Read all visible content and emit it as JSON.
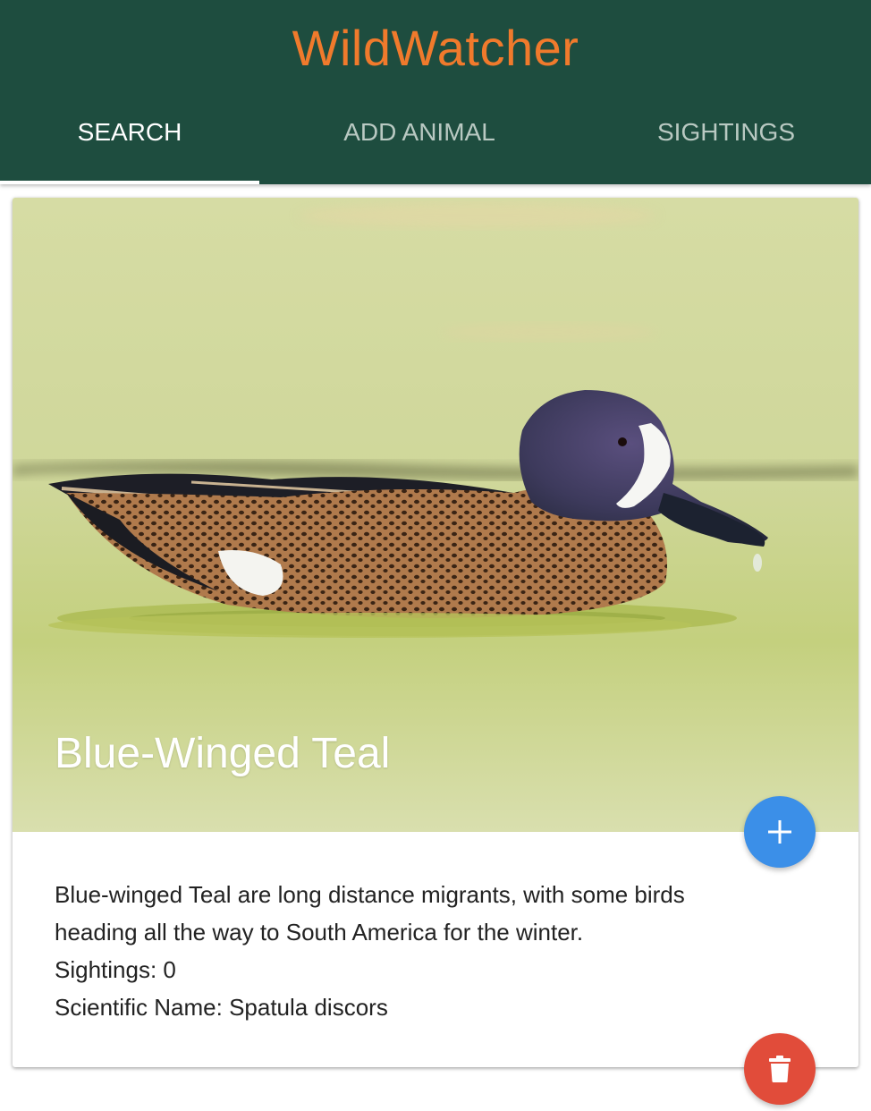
{
  "app": {
    "title": "WildWatcher"
  },
  "tabs": [
    {
      "label": "SEARCH",
      "active": true
    },
    {
      "label": "ADD ANIMAL",
      "active": false
    },
    {
      "label": "SIGHTINGS",
      "active": false
    }
  ],
  "animal": {
    "name": "Blue-Winged Teal",
    "description": "Blue-winged Teal are long distance migrants, with some birds heading all the way to South America for the winter.",
    "sightings_text": "Sightings: 0",
    "scientific_name_text": "Scientific Name: Spatula discors",
    "image_subject": "blue-winged teal duck swimming in duckweed"
  },
  "actions": {
    "add_icon": "plus-icon",
    "delete_icon": "trash-icon"
  },
  "colors": {
    "header_bg": "#1e4d3f",
    "title": "#f07a2c",
    "fab_add": "#3b8fe8",
    "fab_delete": "#e14c3a"
  }
}
